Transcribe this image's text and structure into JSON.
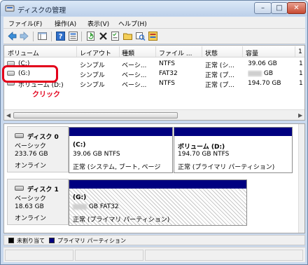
{
  "window": {
    "title": "ディスクの管理"
  },
  "menu": [
    {
      "label": "ファイル(F)"
    },
    {
      "label": "操作(A)"
    },
    {
      "label": "表示(V)"
    },
    {
      "label": "ヘルプ(H)"
    }
  ],
  "volume_table": {
    "columns": [
      "ボリューム",
      "レイアウト",
      "種類",
      "ファイル ...",
      "状態",
      "容量",
      "1"
    ],
    "rows": [
      {
        "volume": "(C:)",
        "layout": "シンプル",
        "type": "ベーシ...",
        "fs": "NTFS",
        "status": "正常 (シ...",
        "capacity": "39.06 GB",
        "extra": "1"
      },
      {
        "volume": "(G:)",
        "layout": "シンプル",
        "type": "ベーシ...",
        "fs": "FAT32",
        "status": "正常 (プ...",
        "capacity": "GB",
        "extra": "1"
      },
      {
        "volume": "ボリューム (D:)",
        "layout": "シンプル",
        "type": "ベーシ...",
        "fs": "NTFS",
        "status": "正常 (プ...",
        "capacity": "194.70 GB",
        "extra": "1"
      }
    ]
  },
  "annotation": {
    "click_label": "クリック"
  },
  "disks": [
    {
      "name": "ディスク 0",
      "type": "ベーシック",
      "size": "233.76 GB",
      "state": "オンライン",
      "partitions": [
        {
          "label": "(C:)",
          "size": "39.06 GB NTFS",
          "status": "正常 (システム, ブート, ページ"
        },
        {
          "label": "ボリューム (D:)",
          "size": "194.70 GB NTFS",
          "status": "正常 (プライマリ パーティション)"
        }
      ]
    },
    {
      "name": "ディスク 1",
      "type": "ベーシック",
      "size": "18.63 GB",
      "state": "オンライン",
      "partitions": [
        {
          "label": "(G:)",
          "size": "GB FAT32",
          "status": "正常 (プライマリ パーティション)"
        }
      ]
    }
  ],
  "legend": [
    {
      "label": "未割り当て",
      "color": "#000000"
    },
    {
      "label": "プライマリ パーティション",
      "color": "#000080"
    }
  ],
  "colors": {
    "accent_red": "#e3001b",
    "partition_bar": "#000080"
  }
}
